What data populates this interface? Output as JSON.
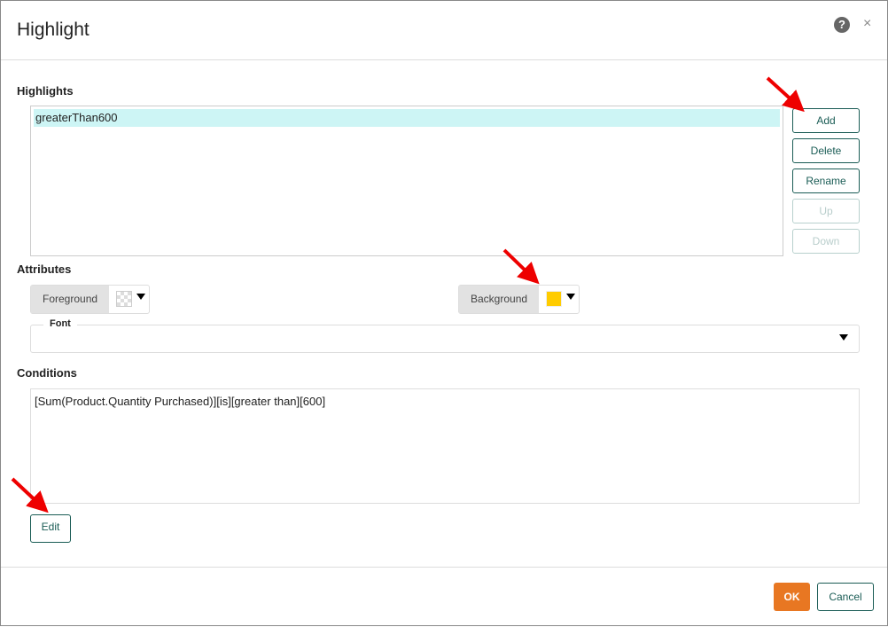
{
  "dialog": {
    "title": "Highlight",
    "help_icon": "question-circle-icon",
    "close_label": "×"
  },
  "highlights": {
    "label": "Highlights",
    "items": [
      "greaterThan600"
    ],
    "buttons": {
      "add": "Add",
      "delete": "Delete",
      "rename": "Rename",
      "up": "Up",
      "down": "Down"
    }
  },
  "attributes": {
    "label": "Attributes",
    "foreground": {
      "label": "Foreground",
      "color": "none"
    },
    "background": {
      "label": "Background",
      "color": "#ffcc00"
    },
    "font": {
      "legend": "Font",
      "value": ""
    }
  },
  "conditions": {
    "label": "Conditions",
    "text": "[Sum(Product.Quantity Purchased)][is][greater than][600]",
    "edit_label": "Edit"
  },
  "footer": {
    "ok": "OK",
    "cancel": "Cancel"
  },
  "colors": {
    "accent": "#1a5c55",
    "primary": "#e87722",
    "selection": "#cdf5f5",
    "annotation_arrow": "#ee0000"
  }
}
